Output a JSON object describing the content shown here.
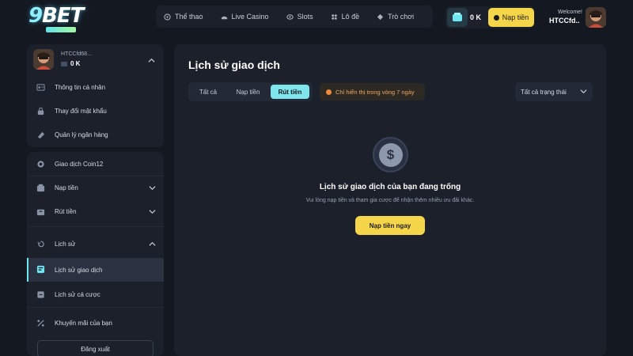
{
  "brand": {
    "logo": "9BET"
  },
  "nav": {
    "items": [
      {
        "label": "Thể thao",
        "icon": "soccer-ball-icon"
      },
      {
        "label": "Live Casino",
        "icon": "casino-table-icon"
      },
      {
        "label": "Slots",
        "icon": "slots-icon"
      },
      {
        "label": "Lô đề",
        "icon": "lottery-icon"
      },
      {
        "label": "Trò chơi",
        "icon": "gamepad-icon"
      }
    ]
  },
  "header": {
    "balance": "0 K",
    "deposit_label": "Nạp tiền",
    "welcome": "Welcome!",
    "username": "HTCCfd.."
  },
  "sidebar": {
    "profile": {
      "name": "HTCCfd68...",
      "balance": "0 K"
    },
    "account_items": [
      {
        "label": "Thông tin cá nhân"
      },
      {
        "label": "Thay đổi mật khẩu"
      },
      {
        "label": "Quản lý ngân hàng"
      }
    ],
    "items": [
      {
        "label": "Giao dịch Coin12"
      },
      {
        "label": "Nạp tiền"
      },
      {
        "label": "Rút tiền"
      },
      {
        "label": "Lịch sử"
      },
      {
        "label": "Lịch sử giao dịch"
      },
      {
        "label": "Lịch sử cá cược"
      },
      {
        "label": "Khuyến mãi của bạn"
      }
    ],
    "logout": "Đăng xuất"
  },
  "main": {
    "title": "Lịch sử giao dịch",
    "tabs": [
      {
        "label": "Tất cả"
      },
      {
        "label": "Nạp tiền"
      },
      {
        "label": "Rút tiền"
      }
    ],
    "active_tab": "Rút tiền",
    "notice": "Chỉ hiển thị trong vòng 7 ngày",
    "status_filter": "Tất cả trạng thái",
    "empty": {
      "title": "Lịch sử giao dịch của bạn đang trống",
      "subtitle": "Vui lòng nạp tiền và tham gia cược để nhận thêm nhiều ưu đãi khác.",
      "button": "Nạp tiền ngay"
    }
  },
  "colors": {
    "background": "#141821",
    "panel": "#1b202b",
    "accent": "#7fe5ec",
    "cta": "#f5d64a",
    "notice": "#f0a65a"
  }
}
